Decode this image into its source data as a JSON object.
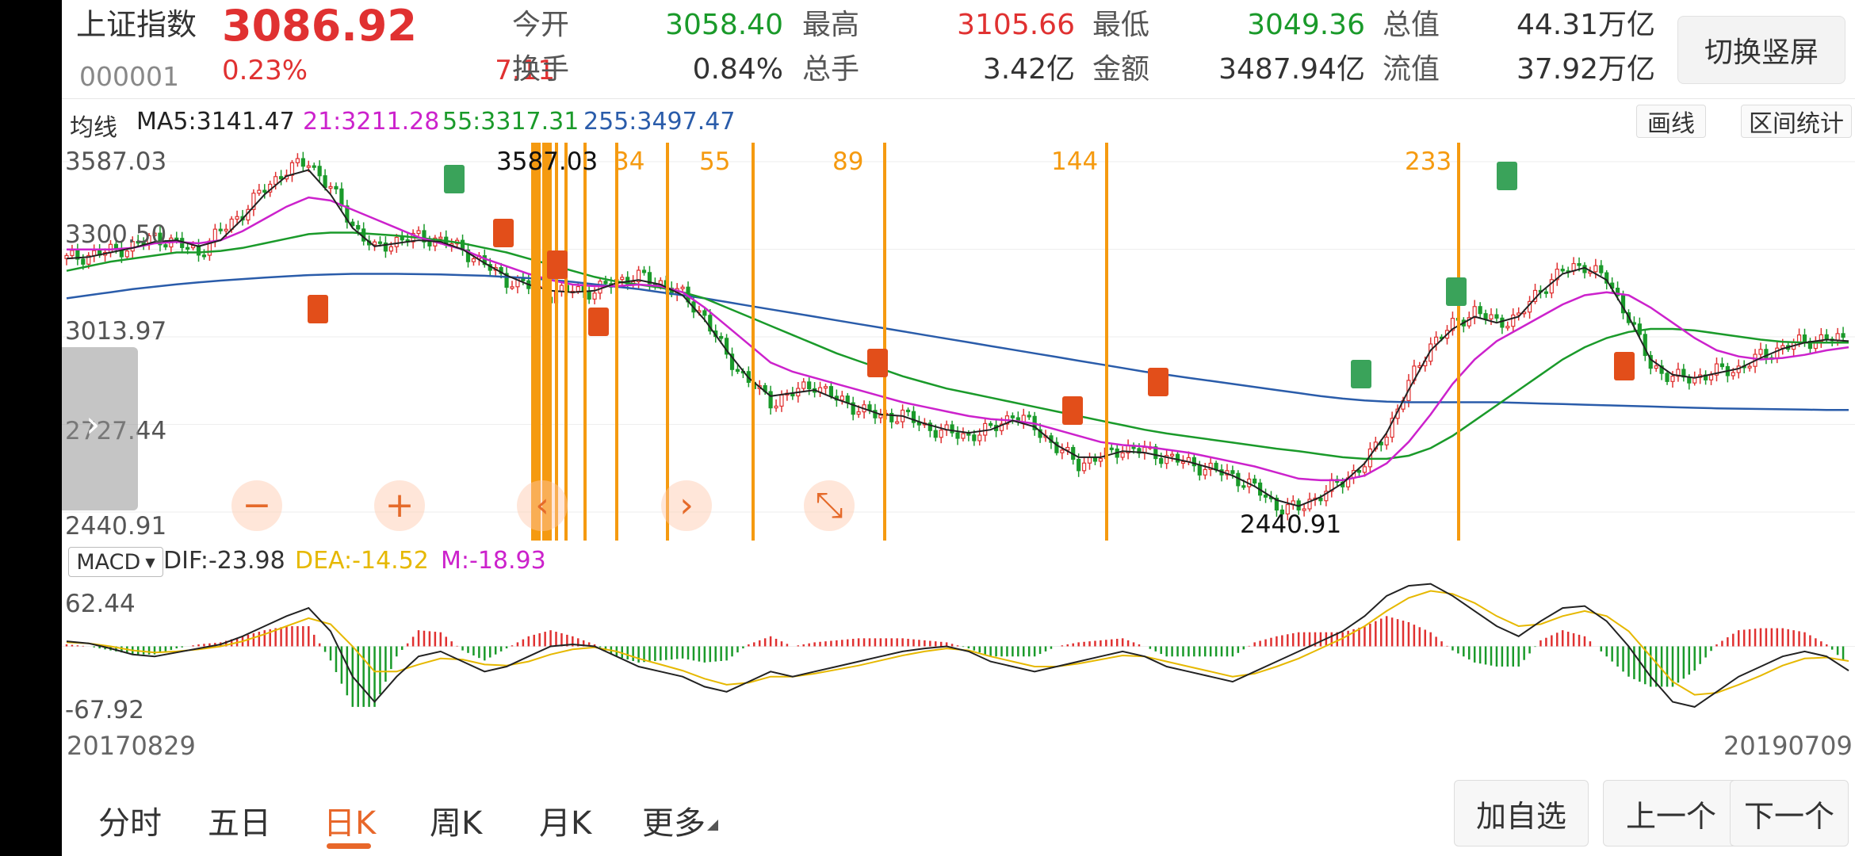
{
  "quote": {
    "name": "上证指数",
    "price": "3086.92",
    "code": "000001",
    "change_pct": "0.23%",
    "change": "7.11",
    "open_label": "今开",
    "open": "3058.40",
    "high_label": "最高",
    "high": "3105.66",
    "low_label": "最低",
    "low": "3049.36",
    "total_value_label": "总值",
    "total_value": "44.31万亿",
    "turnover_rate_label": "换手",
    "turnover_rate": "0.84%",
    "volume_label": "总手",
    "volume": "3.42亿",
    "amount_label": "金额",
    "amount": "3487.94亿",
    "float_value_label": "流值",
    "float_value": "37.92万亿",
    "switch_label": "切换竖屏"
  },
  "ma": {
    "label": "均线",
    "ma5": "MA5:3141.47",
    "ma21": "21:3211.28",
    "ma55": "55:3317.31",
    "ma255": "255:3497.47",
    "draw_label": "画线",
    "range_label": "区间统计"
  },
  "macd": {
    "selector": "MACD",
    "dif": "DIF:-23.98",
    "dea": "DEA:-14.52",
    "m": "M:-18.93"
  },
  "dates": {
    "start": "20170829",
    "end": "20190709"
  },
  "fib_labels": [
    "34",
    "55",
    "89",
    "144",
    "233"
  ],
  "annotations": {
    "high_marker": "3587.03",
    "low_marker": "2440.91"
  },
  "tabs": [
    "分时",
    "五日",
    "日K",
    "周K",
    "月K",
    "更多"
  ],
  "active_tab": 2,
  "buttons": {
    "add": "加自选",
    "prev": "上一个",
    "next": "下一个"
  },
  "controls": {
    "zoom_out": "−",
    "zoom_in": "+",
    "pan_left": "‹",
    "pan_right": "›",
    "expand": "⤡",
    "side": "›"
  },
  "colors": {
    "up": "#e03131",
    "down": "#1a9a2a",
    "ma5": "#222222",
    "ma21": "#cc22cc",
    "ma55": "#1a9a2a",
    "ma255": "#2a5caa",
    "fib": "#f59a10",
    "dea": "#e6b800"
  },
  "chart_data": {
    "type": "candlestick",
    "y_ticks": [
      "3587.03",
      "3300.50",
      "3013.97",
      "2727.44",
      "2440.91"
    ],
    "ylim": [
      2440.91,
      3587.03
    ],
    "price_trend": [
      3270,
      3280,
      3295,
      3310,
      3340,
      3320,
      3290,
      3360,
      3420,
      3500,
      3560,
      3587,
      3500,
      3380,
      3300,
      3330,
      3340,
      3330,
      3300,
      3250,
      3200,
      3180,
      3150,
      3170,
      3160,
      3200,
      3210,
      3190,
      3150,
      3080,
      2950,
      2870,
      2800,
      2830,
      2860,
      2810,
      2780,
      2750,
      2760,
      2720,
      2700,
      2690,
      2710,
      2760,
      2720,
      2650,
      2600,
      2620,
      2650,
      2640,
      2620,
      2600,
      2580,
      2560,
      2520,
      2460,
      2450,
      2500,
      2540,
      2600,
      2700,
      2860,
      2990,
      3050,
      3100,
      3060,
      3080,
      3170,
      3230,
      3250,
      3200,
      3080,
      2920,
      2880,
      2880,
      2900,
      2910,
      2950,
      2980,
      3000,
      3010,
      3000
    ],
    "ma5_line": [
      3270,
      3275,
      3290,
      3305,
      3325,
      3330,
      3310,
      3330,
      3400,
      3480,
      3540,
      3560,
      3480,
      3370,
      3310,
      3320,
      3330,
      3325,
      3300,
      3255,
      3215,
      3185,
      3165,
      3160,
      3165,
      3190,
      3200,
      3185,
      3150,
      3070,
      2970,
      2880,
      2820,
      2830,
      2840,
      2810,
      2785,
      2760,
      2755,
      2730,
      2710,
      2700,
      2710,
      2740,
      2720,
      2660,
      2620,
      2620,
      2640,
      2635,
      2620,
      2605,
      2585,
      2560,
      2525,
      2480,
      2460,
      2490,
      2535,
      2600,
      2700,
      2840,
      2970,
      3040,
      3080,
      3060,
      3080,
      3160,
      3220,
      3240,
      3200,
      3080,
      2940,
      2890,
      2880,
      2895,
      2910,
      2945,
      2975,
      2995,
      3005,
      3000
    ],
    "ma21_line": [
      3300,
      3300,
      3300,
      3305,
      3320,
      3325,
      3320,
      3330,
      3360,
      3400,
      3440,
      3470,
      3460,
      3430,
      3400,
      3370,
      3340,
      3320,
      3300,
      3270,
      3245,
      3220,
      3200,
      3185,
      3180,
      3180,
      3185,
      3180,
      3160,
      3110,
      3050,
      2990,
      2930,
      2900,
      2880,
      2860,
      2840,
      2820,
      2800,
      2785,
      2770,
      2755,
      2745,
      2740,
      2730,
      2710,
      2690,
      2670,
      2660,
      2655,
      2645,
      2635,
      2620,
      2605,
      2590,
      2570,
      2550,
      2545,
      2545,
      2560,
      2600,
      2670,
      2760,
      2860,
      2940,
      3000,
      3040,
      3080,
      3120,
      3150,
      3160,
      3150,
      3110,
      3060,
      3010,
      2970,
      2950,
      2940,
      2945,
      2955,
      2970,
      2980
    ],
    "ma55_line": [
      3230,
      3245,
      3260,
      3270,
      3280,
      3290,
      3290,
      3295,
      3305,
      3320,
      3335,
      3350,
      3355,
      3355,
      3350,
      3345,
      3338,
      3330,
      3320,
      3305,
      3290,
      3270,
      3250,
      3230,
      3210,
      3195,
      3185,
      3175,
      3160,
      3140,
      3110,
      3080,
      3050,
      3020,
      2990,
      2960,
      2935,
      2910,
      2885,
      2865,
      2845,
      2830,
      2815,
      2800,
      2785,
      2770,
      2755,
      2740,
      2725,
      2710,
      2698,
      2688,
      2678,
      2668,
      2658,
      2648,
      2640,
      2630,
      2620,
      2615,
      2615,
      2625,
      2650,
      2690,
      2740,
      2790,
      2840,
      2890,
      2940,
      2980,
      3010,
      3030,
      3040,
      3040,
      3035,
      3025,
      3015,
      3005,
      2998,
      2995,
      2995,
      2995
    ],
    "ma255_line": [
      3140,
      3150,
      3160,
      3170,
      3178,
      3186,
      3192,
      3198,
      3203,
      3208,
      3212,
      3216,
      3218,
      3220,
      3220,
      3220,
      3219,
      3218,
      3216,
      3214,
      3210,
      3206,
      3200,
      3194,
      3186,
      3178,
      3170,
      3160,
      3150,
      3140,
      3128,
      3116,
      3104,
      3092,
      3080,
      3068,
      3056,
      3044,
      3032,
      3020,
      3008,
      2996,
      2984,
      2972,
      2960,
      2948,
      2936,
      2924,
      2912,
      2900,
      2890,
      2880,
      2870,
      2860,
      2850,
      2840,
      2830,
      2820,
      2812,
      2806,
      2802,
      2800,
      2800,
      2800,
      2800,
      2800,
      2798,
      2796,
      2794,
      2792,
      2790,
      2788,
      2786,
      2784,
      2782,
      2780,
      2779,
      2778,
      2777,
      2776,
      2775,
      2775
    ],
    "macd_ylim": [
      -67.92,
      62.44
    ],
    "macd_y_ticks": [
      "62.44",
      "-67.92"
    ],
    "dif_line": [
      5,
      3,
      -2,
      -8,
      -10,
      -6,
      -2,
      2,
      10,
      20,
      30,
      38,
      15,
      -30,
      -55,
      -30,
      -10,
      -5,
      -15,
      -25,
      -20,
      -10,
      0,
      2,
      0,
      -10,
      -20,
      -25,
      -30,
      -40,
      -45,
      -35,
      -25,
      -30,
      -25,
      -20,
      -15,
      -10,
      -5,
      -2,
      0,
      -5,
      -15,
      -20,
      -25,
      -20,
      -15,
      -10,
      -5,
      -10,
      -20,
      -25,
      -30,
      -35,
      -25,
      -15,
      -5,
      5,
      15,
      30,
      50,
      60,
      62,
      50,
      35,
      20,
      10,
      25,
      38,
      40,
      25,
      0,
      -30,
      -55,
      -60,
      -45,
      -30,
      -20,
      -10,
      -5,
      -10,
      -24
    ],
    "dea_line": [
      4,
      3,
      0,
      -4,
      -6,
      -5,
      -3,
      0,
      5,
      12,
      20,
      28,
      22,
      0,
      -25,
      -25,
      -18,
      -12,
      -13,
      -18,
      -19,
      -15,
      -8,
      -3,
      -1,
      -5,
      -12,
      -18,
      -24,
      -32,
      -38,
      -36,
      -30,
      -30,
      -27,
      -23,
      -19,
      -14,
      -9,
      -5,
      -2,
      -4,
      -10,
      -15,
      -20,
      -20,
      -17,
      -13,
      -9,
      -10,
      -15,
      -20,
      -25,
      -30,
      -27,
      -20,
      -12,
      -2,
      8,
      20,
      35,
      48,
      55,
      52,
      43,
      30,
      20,
      22,
      30,
      35,
      30,
      15,
      -10,
      -35,
      -48,
      -46,
      -38,
      -29,
      -19,
      -12,
      -11,
      -14.52
    ]
  }
}
